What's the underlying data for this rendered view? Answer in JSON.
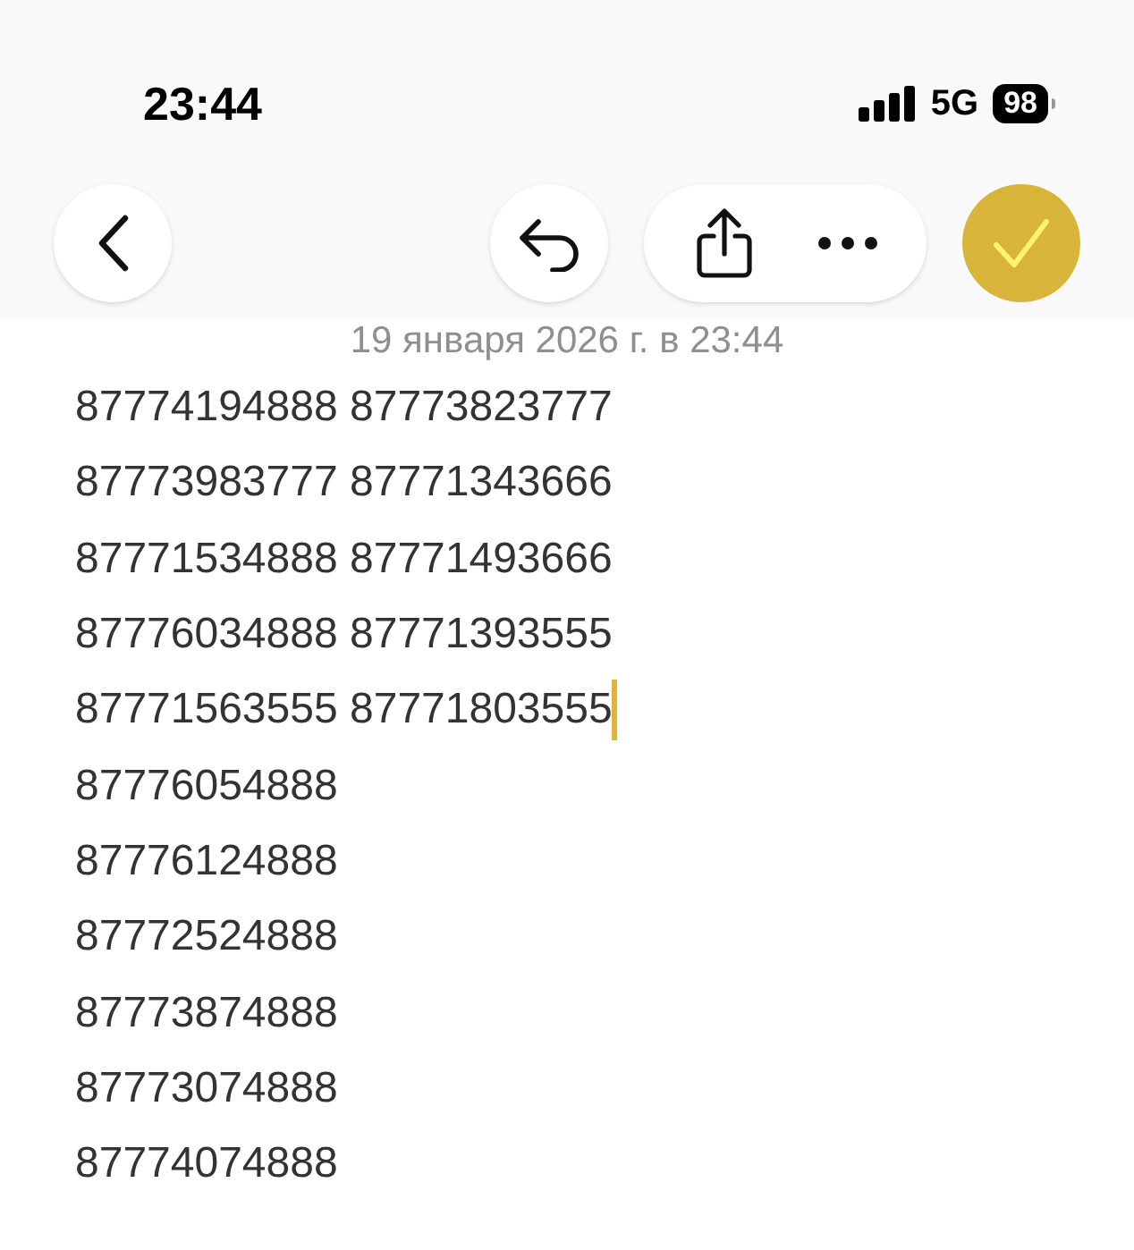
{
  "status_bar": {
    "time": "23:44",
    "network": "5G",
    "battery": "98"
  },
  "toolbar": {
    "done": {
      "checked": true
    }
  },
  "note": {
    "date": "19 января 2026 г. в 23:44",
    "lines": [
      {
        "text": "87774194888 87773823777",
        "caret": false
      },
      {
        "text": "87773983777 87771343666",
        "caret": false
      },
      {
        "text": "87771534888 87771493666",
        "caret": false
      },
      {
        "text": "87776034888 87771393555",
        "caret": false
      },
      {
        "text": "87771563555 87771803555",
        "caret": true
      },
      {
        "text": "87776054888",
        "caret": false
      },
      {
        "text": "87776124888",
        "caret": false
      },
      {
        "text": "87772524888",
        "caret": false
      },
      {
        "text": "87773874888",
        "caret": false
      },
      {
        "text": "87773074888",
        "caret": false
      },
      {
        "text": "87774074888",
        "caret": false
      }
    ]
  }
}
